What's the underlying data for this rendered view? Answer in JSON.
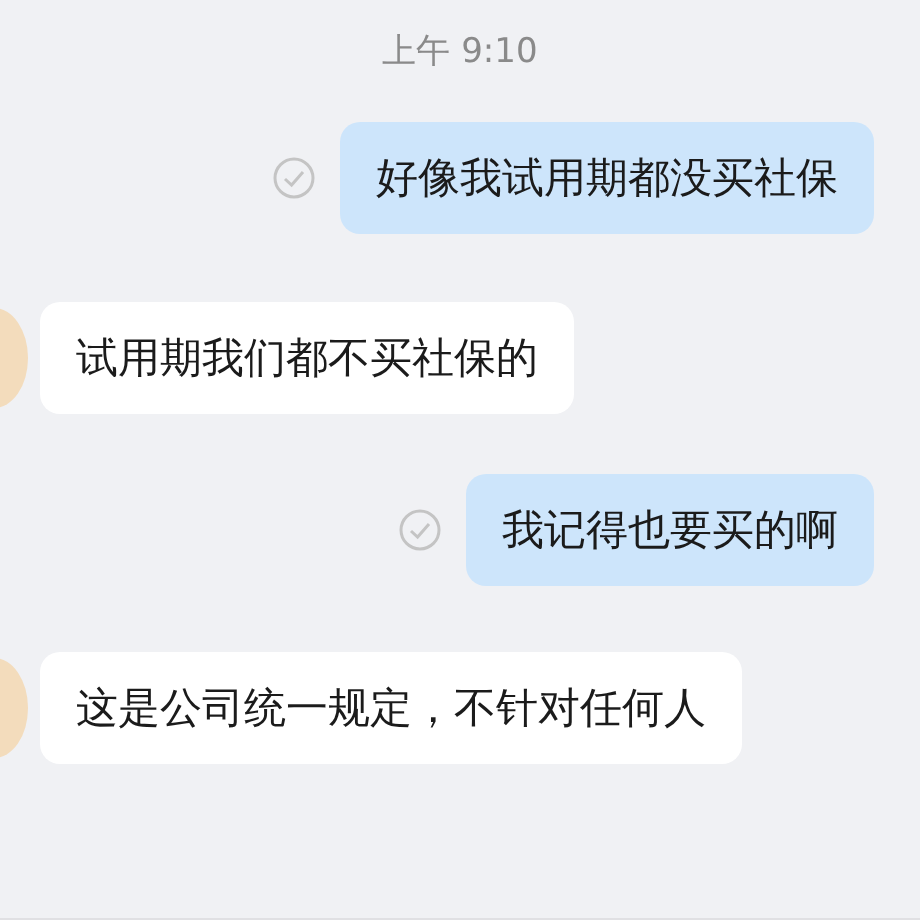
{
  "timestamp": "上午 9:10",
  "messages": [
    {
      "kind": "outgoing",
      "text": "好像我试用期都没买社保",
      "read": true
    },
    {
      "kind": "incoming",
      "text": "试用期我们都不买社保的"
    },
    {
      "kind": "outgoing",
      "text": "我记得也要买的啊",
      "read": true
    },
    {
      "kind": "incoming",
      "text": "这是公司统一规定，不针对任何人"
    }
  ]
}
